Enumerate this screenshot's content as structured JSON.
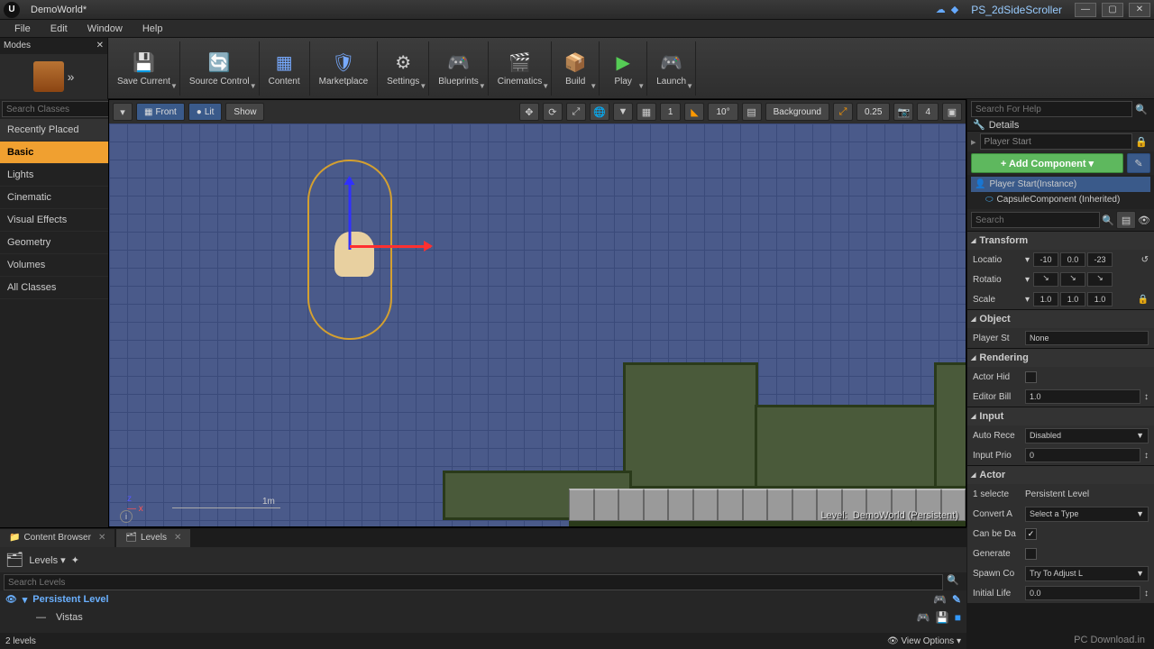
{
  "titlebar": {
    "project": "DemoWorld*",
    "solution": "PS_2dSideScroller"
  },
  "menu": {
    "file": "File",
    "edit": "Edit",
    "window": "Window",
    "help": "Help"
  },
  "toolbar": {
    "modes": "Modes",
    "save": "Save Current",
    "source": "Source Control",
    "content": "Content",
    "market": "Marketplace",
    "settings": "Settings",
    "blueprints": "Blueprints",
    "cinematics": "Cinematics",
    "build": "Build",
    "play": "Play",
    "launch": "Launch"
  },
  "placement": {
    "search_ph": "Search Classes",
    "recent": "Recently Placed",
    "basic": "Basic",
    "lights": "Lights",
    "cinematic": "Cinematic",
    "vfx": "Visual Effects",
    "geometry": "Geometry",
    "volumes": "Volumes",
    "all": "All Classes"
  },
  "vp": {
    "front": "Front",
    "lit": "Lit",
    "show": "Show",
    "grid": "1",
    "angle": "10°",
    "bg": "Background",
    "scale": "0.25",
    "cam": "4",
    "scale_label": "1m",
    "level_label": "Level:",
    "level_name": "DemoWorld (Persistent)"
  },
  "details": {
    "title": "Details",
    "actor": "Player Start",
    "add": "+ Add Component ▾",
    "root": "Player Start(Instance)",
    "capsule": "CapsuleComponent (Inherited)",
    "search_ph": "Search",
    "transform": "Transform",
    "loc": "Locatio",
    "loc_x": "-10",
    "loc_y": "0.0",
    "loc_z": "-23",
    "rot": "Rotatio",
    "scl": "Scale",
    "scl_x": "1.0",
    "scl_y": "1.0",
    "scl_z": "1.0",
    "object": "Object",
    "player_start": "Player St",
    "none": "None",
    "rendering": "Rendering",
    "actor_hid": "Actor Hid",
    "editor_bill": "Editor Bill",
    "bill_val": "1.0",
    "input": "Input",
    "auto_recv": "Auto Rece",
    "disabled": "Disabled",
    "input_prio": "Input Prio",
    "prio_val": "0",
    "actor_cat": "Actor",
    "sel_txt": "1 selecte",
    "persist": "Persistent Level",
    "convert": "Convert A",
    "select_type": "Select a Type",
    "can_be": "Can be Da",
    "generate": "Generate",
    "spawn": "Spawn Co",
    "spawn_val": "Try To Adjust L",
    "init_life": "Initial Life",
    "life_val": "0.0"
  },
  "search_help_ph": "Search For Help",
  "bottom": {
    "tab_content": "Content Browser",
    "tab_levels": "Levels",
    "levels_menu": "Levels",
    "search_ph": "Search Levels",
    "persist": "Persistent Level",
    "sub1": "Vistas",
    "count": "2 levels",
    "view_opts": "View Options"
  },
  "footer": "PC Download.in"
}
